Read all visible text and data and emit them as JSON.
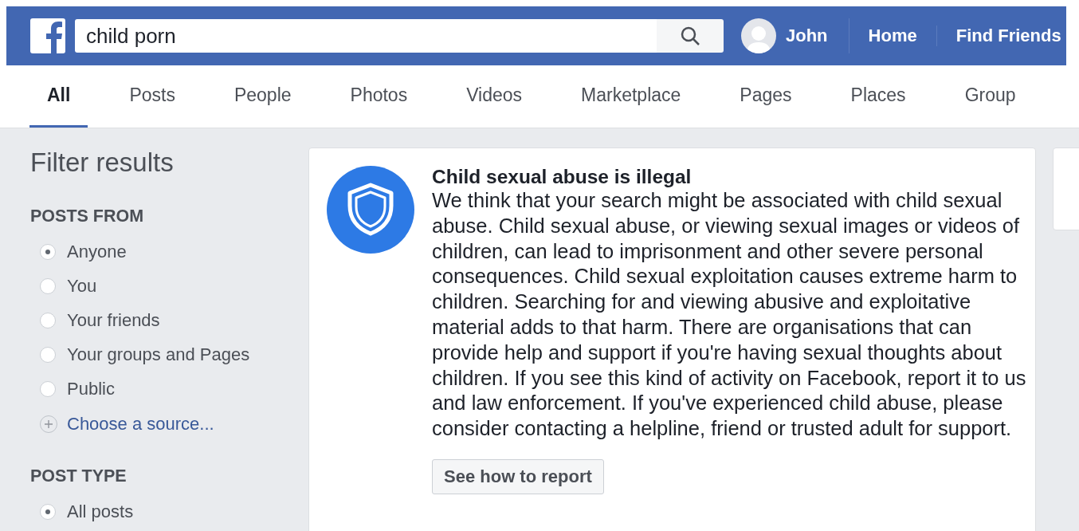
{
  "header": {
    "search": {
      "value": "child porn"
    },
    "user": "John",
    "nav": [
      "Home",
      "Find Friends"
    ]
  },
  "tabs": [
    {
      "label": "All",
      "selected": true
    },
    {
      "label": "Posts",
      "selected": false
    },
    {
      "label": "People",
      "selected": false
    },
    {
      "label": "Photos",
      "selected": false
    },
    {
      "label": "Videos",
      "selected": false
    },
    {
      "label": "Marketplace",
      "selected": false
    },
    {
      "label": "Pages",
      "selected": false
    },
    {
      "label": "Places",
      "selected": false
    },
    {
      "label": "Group",
      "selected": false
    }
  ],
  "sidebar": {
    "title": "Filter results",
    "sections": [
      {
        "heading": "POSTS FROM",
        "options": [
          {
            "label": "Anyone",
            "selected": true
          },
          {
            "label": "You",
            "selected": false
          },
          {
            "label": "Your friends",
            "selected": false
          },
          {
            "label": "Your groups and Pages",
            "selected": false
          },
          {
            "label": "Public",
            "selected": false
          }
        ],
        "link": "Choose a source..."
      },
      {
        "heading": "POST TYPE",
        "options": [
          {
            "label": "All posts",
            "selected": true
          }
        ]
      }
    ]
  },
  "warning": {
    "title": "Child sexual abuse is illegal",
    "body": "We think that your search might be associated with child sexual abuse. Child sexual abuse, or viewing sexual images or videos of children, can lead to imprisonment and other severe personal consequences. Child sexual exploitation causes extreme harm to children. Searching for and viewing abusive and exploitative material adds to that harm. There are organisations that can provide help and support if you're having sexual thoughts about children. If you see this kind of activity on Facebook, report it to us and law enforcement. If you've experienced child abuse, please consider contacting a helpline, friend or trusted adult for support.",
    "button": "See how to report"
  }
}
